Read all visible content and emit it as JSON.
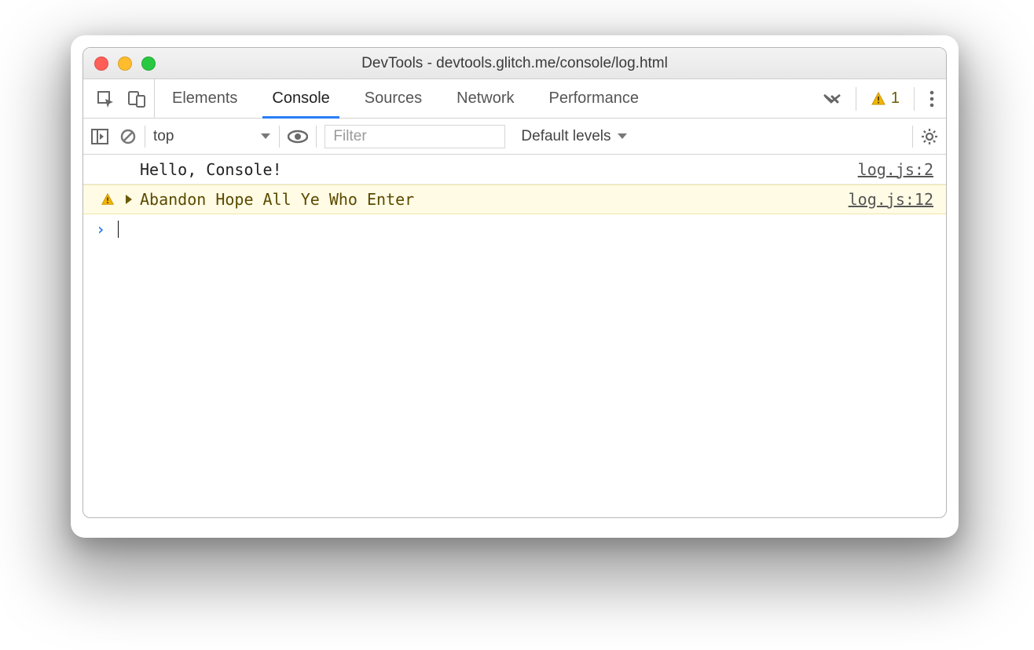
{
  "window": {
    "title": "DevTools - devtools.glitch.me/console/log.html"
  },
  "tabs": {
    "items": [
      "Elements",
      "Console",
      "Sources",
      "Network",
      "Performance"
    ],
    "active": "Console",
    "warning_count": "1"
  },
  "toolbar": {
    "context": "top",
    "filter_placeholder": "Filter",
    "levels_label": "Default levels"
  },
  "console": {
    "rows": [
      {
        "type": "log",
        "msg": "Hello, Console!",
        "src": "log.js:2"
      },
      {
        "type": "warn",
        "msg": "Abandon Hope All Ye Who Enter",
        "src": "log.js:12"
      }
    ]
  }
}
